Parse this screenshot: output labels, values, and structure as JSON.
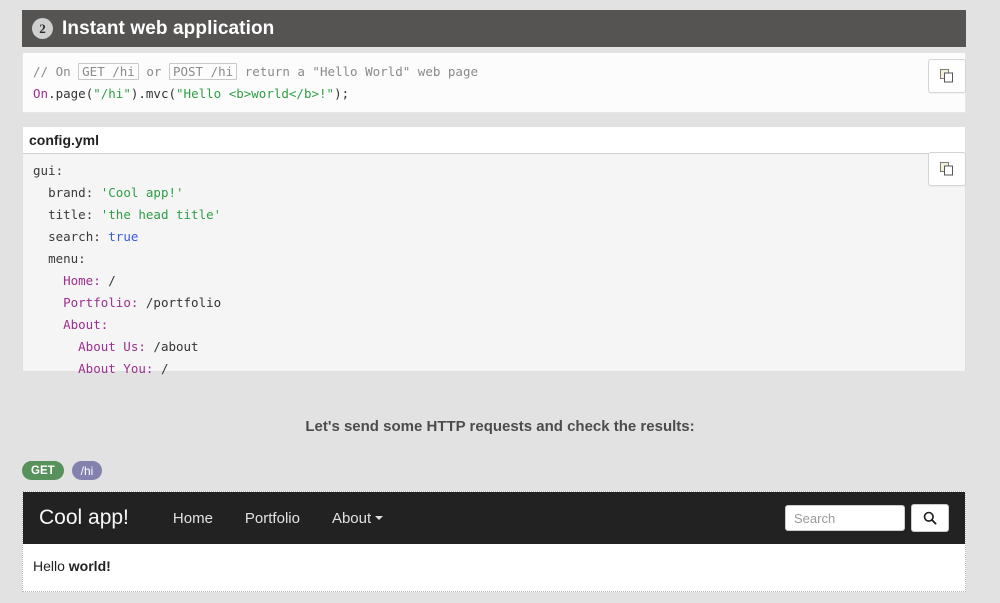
{
  "section": {
    "step": "2",
    "title": "Instant web application"
  },
  "java_code": {
    "comment_prefix": "// On ",
    "chip_get": "GET /hi",
    "comment_mid": " or ",
    "chip_post": "POST /hi",
    "comment_suffix": " return a \"Hello World\" web page",
    "line2": {
      "ident": "On",
      "call1": ".page(",
      "str1": "\"/hi\"",
      "call2": ").mvc(",
      "str2": "\"Hello <b>world</b>!\"",
      "call3": ");"
    },
    "copy_label": "copy-icon"
  },
  "config": {
    "filename": "config.yml",
    "copy_label": "copy-icon",
    "lines": [
      {
        "indent": 0,
        "key": "gui:",
        "value": "",
        "type": "key"
      },
      {
        "indent": 2,
        "key": "brand:",
        "value": "'Cool app!'",
        "type": "string"
      },
      {
        "indent": 2,
        "key": "title:",
        "value": "'the head title'",
        "type": "string"
      },
      {
        "indent": 2,
        "key": "search:",
        "value": "true",
        "type": "bool"
      },
      {
        "indent": 2,
        "key": "menu:",
        "value": "",
        "type": "key"
      },
      {
        "indent": 4,
        "key": "Home:",
        "value": "/",
        "type": "menu"
      },
      {
        "indent": 4,
        "key": "Portfolio:",
        "value": "/portfolio",
        "type": "menu"
      },
      {
        "indent": 4,
        "key": "About:",
        "value": "",
        "type": "menu"
      },
      {
        "indent": 6,
        "key": "About Us:",
        "value": "/about",
        "type": "menu"
      },
      {
        "indent": 6,
        "key": "About You:",
        "value": "/",
        "type": "menu"
      }
    ]
  },
  "prompt": "Let's send some HTTP requests and check the results:",
  "request": {
    "method": "GET",
    "path": "/hi"
  },
  "preview": {
    "brand": "Cool app!",
    "nav": [
      {
        "label": "Home",
        "caret": false
      },
      {
        "label": "Portfolio",
        "caret": false
      },
      {
        "label": "About",
        "caret": true
      }
    ],
    "search_placeholder": "Search",
    "search_value": "",
    "search_icon": "magnifier-icon",
    "body_text": "Hello ",
    "body_bold": "world!"
  },
  "colors": {
    "header_bar": "#555453",
    "page_bg": "#e2e2e2",
    "navbar": "#222222",
    "badge_get": "#57915b",
    "badge_path": "#8481ae",
    "string": "#2e9e45",
    "identifier": "#9b2f8f",
    "bool": "#3b5bdb"
  }
}
